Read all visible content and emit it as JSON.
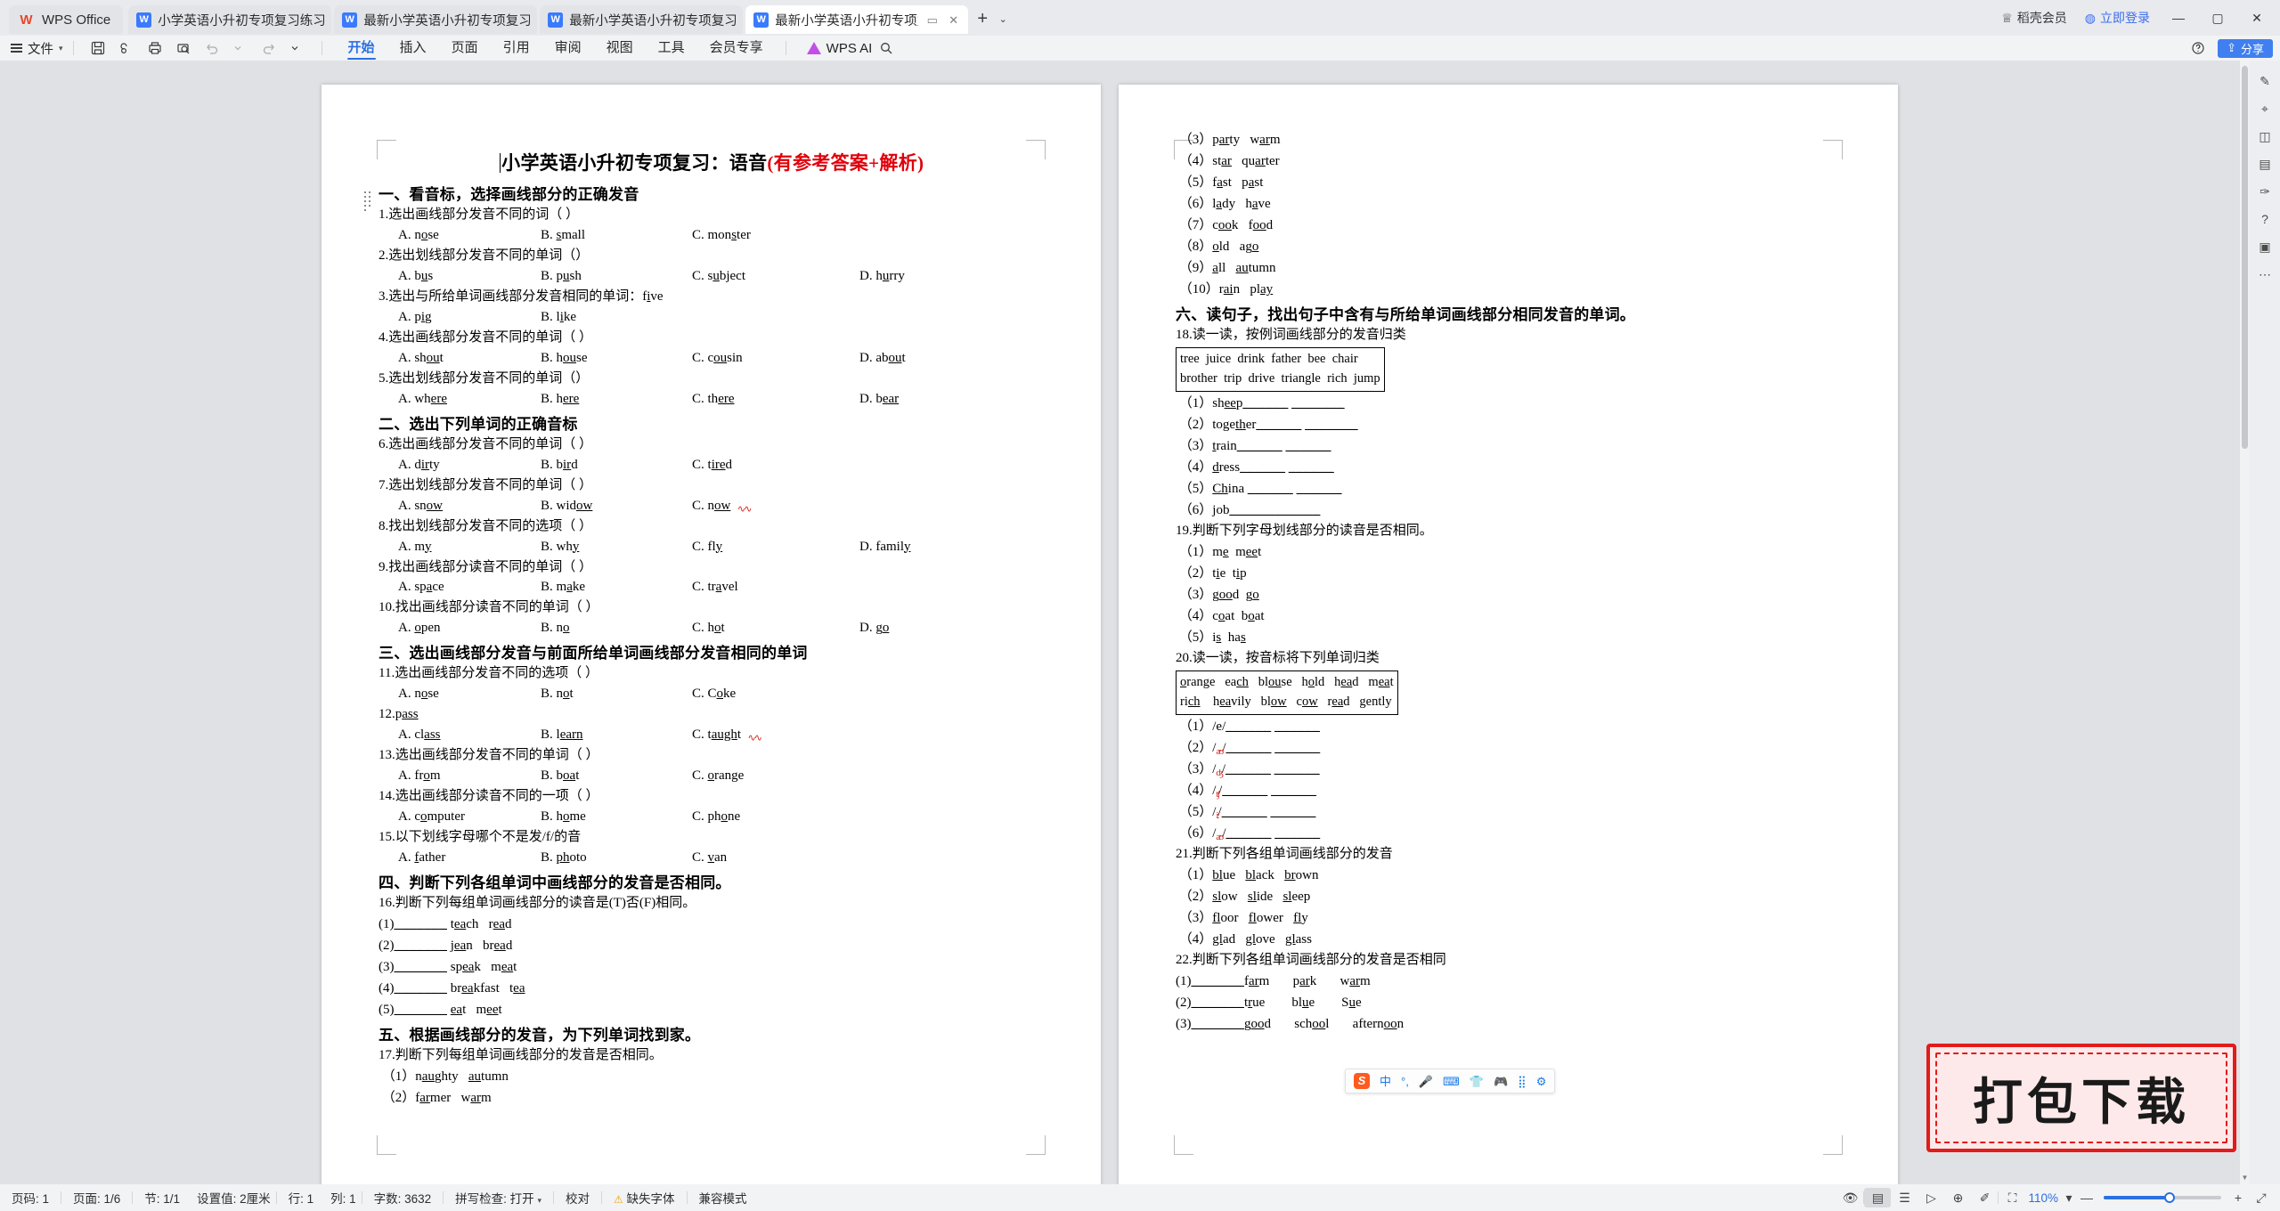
{
  "titlebar": {
    "app_name": "WPS Office",
    "app_logo_glyph": "W",
    "tabs": [
      {
        "label": "小学英语小升初专项复习练习：名词.d",
        "icon": "W",
        "active": false
      },
      {
        "label": "最新小学英语小升初专项复习练习：元",
        "icon": "W",
        "active": false
      },
      {
        "label": "最新小学英语小升初专项复习练习：",
        "icon": "W",
        "active": false
      },
      {
        "label": "最新小学英语小升初专项复习",
        "icon": "W",
        "active": true
      }
    ],
    "new_tab_glyph": "+",
    "tab_list_caret": "⌄",
    "restore_glyph": "▭",
    "close_tab_glyph": "✕",
    "vip_label": "稻壳会员",
    "login_label": "立即登录",
    "minimize": "—",
    "maximize": "▢",
    "close": "✕"
  },
  "menubar": {
    "file_label": "文件",
    "quick_icons": [
      "save-icon",
      "cloud-save-icon",
      "print-icon",
      "print-preview-icon",
      "undo-icon",
      "undo-caret",
      "redo-icon",
      "more-caret"
    ],
    "tabs": [
      {
        "label": "开始",
        "active": true
      },
      {
        "label": "插入",
        "active": false
      },
      {
        "label": "页面",
        "active": false
      },
      {
        "label": "引用",
        "active": false
      },
      {
        "label": "审阅",
        "active": false
      },
      {
        "label": "视图",
        "active": false
      },
      {
        "label": "工具",
        "active": false
      },
      {
        "label": "会员专享",
        "active": false
      }
    ],
    "ai_label": "WPS AI",
    "search_icon": "search-icon",
    "help_icon": "help-icon",
    "share_label": "分享"
  },
  "document": {
    "title_black": "小学英语小升初专项复习：语音",
    "title_red": "(有参考答案+解析)",
    "page1": {
      "sections": [
        {
          "heading": "一、看音标，选择画线部分的正确发音",
          "items": [
            {
              "q": "1.选出画线部分发音不同的词（    ）",
              "opts": [
                {
                  "k": "A.",
                  "pre": "n",
                  "u": "o",
                  "post": "se"
                },
                {
                  "k": "B.",
                  "pre": "",
                  "u": "s",
                  "post": "mall"
                },
                {
                  "k": "C.",
                  "pre": "mon",
                  "u": "s",
                  "post": "ter"
                }
              ]
            },
            {
              "q": "2.选出划线部分发音不同的单词（）",
              "opts": [
                {
                  "k": "A.",
                  "pre": "b",
                  "u": "u",
                  "post": "s"
                },
                {
                  "k": "B.",
                  "pre": "p",
                  "u": "u",
                  "post": "sh"
                },
                {
                  "k": "C.",
                  "pre": "s",
                  "u": "u",
                  "post": "bject"
                },
                {
                  "k": "D.",
                  "pre": "h",
                  "u": "u",
                  "post": "rry"
                }
              ]
            },
            {
              "q": "3.选出与所给单词画线部分发音相同的单词：f<u>i</u>ve",
              "opts": [
                {
                  "k": "A.",
                  "pre": "p",
                  "u": "i",
                  "post": "g"
                },
                {
                  "k": "B.",
                  "pre": "l",
                  "u": "i",
                  "post": "ke"
                }
              ]
            },
            {
              "q": "4.选出画线部分发音不同的单词（   ）",
              "opts": [
                {
                  "k": "A.",
                  "pre": "sh",
                  "u": "ou",
                  "post": "t"
                },
                {
                  "k": "B.",
                  "pre": "h",
                  "u": "ou",
                  "post": "se"
                },
                {
                  "k": "C.",
                  "pre": "c",
                  "u": "ou",
                  "post": "sin"
                },
                {
                  "k": "D.",
                  "pre": "ab",
                  "u": "ou",
                  "post": "t"
                }
              ]
            },
            {
              "q": "5.选出划线部分发音不同的单词（）",
              "opts": [
                {
                  "k": "A.",
                  "pre": "wh",
                  "u": "ere",
                  "post": ""
                },
                {
                  "k": "B.",
                  "pre": "h",
                  "u": "ere",
                  "post": ""
                },
                {
                  "k": "C.",
                  "pre": "th",
                  "u": "ere",
                  "post": ""
                },
                {
                  "k": "D.",
                  "pre": "b",
                  "u": "ear",
                  "post": ""
                }
              ]
            }
          ]
        },
        {
          "heading": "二、选出下列单词的正确音标",
          "items": [
            {
              "q": "6.选出画线部分发音不同的单词（   ）",
              "opts": [
                {
                  "k": "A.",
                  "pre": "d",
                  "u": "ir",
                  "post": "ty"
                },
                {
                  "k": "B.",
                  "pre": "b",
                  "u": "ir",
                  "post": "d"
                },
                {
                  "k": "C.",
                  "pre": "t",
                  "u": "ire",
                  "post": "d"
                }
              ]
            },
            {
              "q": "7.选出划线部分发音不同的单词（   ）",
              "opts": [
                {
                  "k": "A.",
                  "pre": "sn",
                  "u": "ow",
                  "post": ""
                },
                {
                  "k": "B.",
                  "pre": "wid",
                  "u": "ow",
                  "post": ""
                },
                {
                  "k": "C.",
                  "pre": "n",
                  "u": "ow",
                  "post": "",
                  "squiggle": true
                }
              ]
            },
            {
              "q": "8.找出划线部分发音不同的选项（   ）",
              "opts": [
                {
                  "k": "A.",
                  "pre": "m",
                  "u": "y",
                  "post": ""
                },
                {
                  "k": "B.",
                  "pre": "wh",
                  "u": "y",
                  "post": ""
                },
                {
                  "k": "C.",
                  "pre": "fl",
                  "u": "y",
                  "post": ""
                },
                {
                  "k": "D.",
                  "pre": "famil",
                  "u": "y",
                  "post": ""
                }
              ]
            },
            {
              "q": "9.找出画线部分读音不同的单词（   ）",
              "opts": [
                {
                  "k": "A.",
                  "pre": "sp",
                  "u": "a",
                  "post": "ce"
                },
                {
                  "k": "B.",
                  "pre": "m",
                  "u": "a",
                  "post": "ke"
                },
                {
                  "k": "C.",
                  "pre": "tr",
                  "u": "a",
                  "post": "vel"
                }
              ]
            },
            {
              "q": "10.找出画线部分读音不同的单词（   ）",
              "opts": [
                {
                  "k": "A.",
                  "pre": "",
                  "u": "o",
                  "post": "pen"
                },
                {
                  "k": "B.",
                  "pre": "n",
                  "u": "o",
                  "post": ""
                },
                {
                  "k": "C.",
                  "pre": "h",
                  "u": "o",
                  "post": "t"
                },
                {
                  "k": "D.",
                  "pre": "g",
                  "u": "o",
                  "post": ""
                }
              ]
            }
          ]
        },
        {
          "heading": "三、选出画线部分发音与前面所给单词画线部分发音相同的单词",
          "items": [
            {
              "q": "11.选出画线部分发音不同的选项（   ）",
              "opts": [
                {
                  "k": "A.",
                  "pre": "n",
                  "u": "o",
                  "post": "se"
                },
                {
                  "k": "B.",
                  "pre": "n",
                  "u": "o",
                  "post": "t"
                },
                {
                  "k": "C.",
                  "pre": "C",
                  "u": "o",
                  "post": "ke"
                }
              ]
            },
            {
              "q": "12.p<u>ass</u>",
              "opts": [
                {
                  "k": "A.",
                  "pre": "cl",
                  "u": "ass",
                  "post": ""
                },
                {
                  "k": "B.",
                  "pre": "l",
                  "u": "earn",
                  "post": ""
                },
                {
                  "k": "C.",
                  "pre": "t",
                  "u": "augh",
                  "post": "t",
                  "squiggle": true
                }
              ]
            },
            {
              "q": "13.选出画线部分发音不同的单词（   ）",
              "opts": [
                {
                  "k": "A.",
                  "pre": "fr",
                  "u": "o",
                  "post": "m"
                },
                {
                  "k": "B.",
                  "pre": "b",
                  "u": "oa",
                  "post": "t"
                },
                {
                  "k": "C.",
                  "pre": "",
                  "u": "o",
                  "post": "range"
                }
              ]
            },
            {
              "q": "14.选出画线部分读音不同的一项（   ）",
              "opts": [
                {
                  "k": "A.",
                  "pre": "c",
                  "u": "o",
                  "post": "mputer"
                },
                {
                  "k": "B.",
                  "pre": "h",
                  "u": "o",
                  "post": "me"
                },
                {
                  "k": "C.",
                  "pre": "ph",
                  "u": "o",
                  "post": "ne"
                }
              ]
            },
            {
              "q": "15.以下划线字母哪个不是发/f/的音",
              "opts": [
                {
                  "k": "A.",
                  "pre": "",
                  "u": "f",
                  "post": "ather"
                },
                {
                  "k": "B.",
                  "pre": "",
                  "u": "ph",
                  "post": "oto"
                },
                {
                  "k": "C.",
                  "pre": "",
                  "u": "v",
                  "post": "an"
                }
              ]
            }
          ]
        },
        {
          "heading": "四、判断下列各组单词中画线部分的发音是否相同。",
          "prompt": "16.判断下列每组单词画线部分的读音是(T)否(F)相同。",
          "fills": [
            "(1)________  t<u>ea</u>ch   r<u>ea</u>d",
            "(2)________  j<u>ea</u>n   br<u>ea</u>d",
            "(3)________  sp<u>ea</u>k   m<u>ea</u>t",
            "(4)________  br<u>ea</u>kfast   t<u>ea</u>",
            "(5)________  <u>ea</u>t   m<u>ee</u>t"
          ]
        },
        {
          "heading": "五、根据画线部分的发音，为下列单词找到家。",
          "prompt": "17.判断下列每组单词画线部分的发音是否相同。",
          "fills": [
            "（1）n<u>au</u>ghty   <u>au</u>tumn",
            "（2）f<u>ar</u>mer   w<u>ar</u>m"
          ]
        }
      ]
    },
    "page2": {
      "cont_items": [
        "（3）p<u>ar</u>ty   w<u>ar</u>m",
        "（4）st<u>ar</u>   qu<u>ar</u>ter",
        "（5）f<u>a</u>st   p<u>a</u>st",
        "（6）l<u>a</u>dy   h<u>a</u>ve",
        "（7）c<u>oo</u>k   f<u>oo</u>d",
        "（8）<u>o</u>ld   ag<u>o</u>",
        "（9）<u>a</u>ll   <u>au</u>tumn",
        "（10）r<u>ai</u>n   pl<u>ay</u>"
      ],
      "section6_heading": "六、读句子，找出句子中含有与所给单词画线部分相同发音的单词。",
      "q18_prompt": "18.读一读，按例词画线部分的发音归类",
      "q18_box": [
        [
          "tree",
          "juice",
          "drink",
          "father",
          "bee",
          "chair"
        ],
        [
          "brother",
          "trip",
          "drive",
          "triangle",
          "rich",
          "jump"
        ]
      ],
      "q18_fills": [
        "（1）sh<u>ee</u>p_______ _______",
        "（2）toge<u>th</u>er_______ _______",
        "（3）<u>t</u>rain_______ _______",
        "（4）<u>d</u>ress_______ _______",
        "（5）<u>Ch</u>ina _______ _______",
        "（6）<u>j</u>ob______ ______"
      ],
      "q19_prompt": "19.判断下列字母划线部分的读音是否相同。",
      "q19_fills": [
        "（1）m<u>e</u>  m<u>ee</u>t",
        "（2）t<u>i</u>e  t<u>i</u>p",
        "（3）g<u>oo</u>d  g<u>o</u>",
        "（4）c<u>o</u>at  b<u>o</u>at",
        "（5）i<u>s</u>  ha<u>s</u>"
      ],
      "q20_prompt": "20.读一读，按音标将下列单词归类",
      "q20_box": [
        [
          "orange",
          "each",
          "blouse",
          "hold",
          "head",
          "meat"
        ],
        [
          "rich",
          "heavily",
          "blow",
          "cow",
          "read",
          "gently"
        ]
      ],
      "q20_fills": [
        "（1）/e/_______  _______",
        "（2）/əʊ/_______  _______",
        "（3）/dʒ/_______  _______",
        "（4）/tʃ/_______  _______",
        "（5）/iː/_______  _______",
        "（6）/aʊ/_______  _______"
      ],
      "q21_prompt": "21.判断下列各组单词画线部分的发音",
      "q21_fills": [
        "（1）<u>bl</u>ue   <u>bl</u>ack   <u>br</u>own",
        "（2）<u>sl</u>ow   <u>sl</u>ide   <u>sl</u>eep",
        "（3）<u>fl</u>oor   <u>fl</u>ower   <u>fl</u>y",
        "（4）<u>gl</u>ad   <u>gl</u>ove   <u>gl</u>ass"
      ],
      "q22_prompt": "22.判断下列各组单词画线部分的发音是否相同",
      "q22_fills": [
        "(1)_______f<u>ar</u>m        p<u>ar</u>k        w<u>ar</u>m",
        "(2)_______t<u>r</u>ue        bl<u>u</u>e        S<u>u</u>e",
        "(3)_______g<u>oo</u>d        sch<u>oo</u>l        aftern<u>oo</u>n"
      ]
    }
  },
  "statusbar": {
    "page_number": "页码: 1",
    "page_count": "页面: 1/6",
    "section": "节: 1/1",
    "setting": "设置值: 2厘米",
    "row": "行: 1",
    "col": "列: 1",
    "word_count": "字数: 3632",
    "spellcheck": "拼写检查: 打开",
    "proofread": "校对",
    "missing_font": "缺失字体",
    "compat_mode": "兼容模式",
    "zoom": "110%",
    "zoom_minus": "—",
    "zoom_plus": "+",
    "view_icons": [
      "eye-icon",
      "page-view-icon",
      "outline-view-icon",
      "reading-view-icon",
      "web-view-icon",
      "highlight-icon",
      "fullscreen-icon"
    ]
  },
  "ime_bar": {
    "logo": "S",
    "mode": "中",
    "punct": "°,",
    "icons": [
      "microphone-icon",
      "keyboard-icon",
      "skin-icon",
      "game-icon",
      "apps-icon",
      "settings-icon"
    ]
  },
  "watermark": {
    "text": "打包下载",
    "border_color": "#e21b1b"
  },
  "rail_icons": [
    "pen-icon",
    "cursor-icon",
    "shape-icon",
    "doc-icon",
    "brush-icon",
    "help-icon",
    "image-icon",
    "more-icon"
  ]
}
